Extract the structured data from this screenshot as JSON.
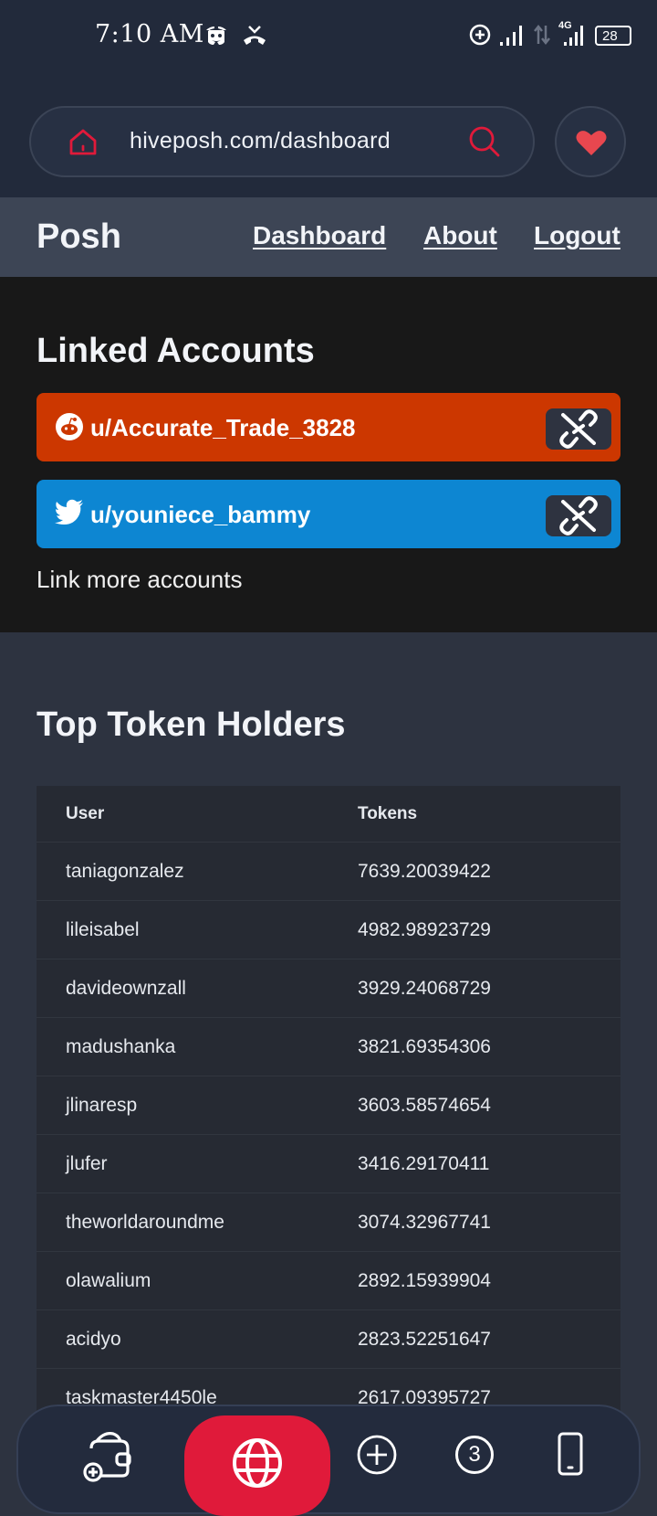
{
  "status": {
    "time": "7:10 AM",
    "network": "4G",
    "battery": "28"
  },
  "browser": {
    "url": "hiveposh.com/dashboard",
    "icons": [
      "home-icon",
      "search-icon",
      "heart-icon"
    ]
  },
  "nav": {
    "brand": "Posh",
    "links": [
      "Dashboard",
      "About",
      "Logout"
    ]
  },
  "linked": {
    "title": "Linked Accounts",
    "accounts": [
      {
        "platform": "reddit",
        "name": "u/Accurate_Trade_3828",
        "color": "#cc3700"
      },
      {
        "platform": "twitter",
        "name": "u/youniece_bammy",
        "color": "#0d86d2"
      }
    ],
    "link_more": "Link more accounts"
  },
  "holders": {
    "title": "Top Token Holders",
    "columns": [
      "User",
      "Tokens"
    ],
    "rows": [
      {
        "user": "taniagonzalez",
        "tokens": "7639.20039422"
      },
      {
        "user": "lileisabel",
        "tokens": "4982.98923729"
      },
      {
        "user": "davideownzall",
        "tokens": "3929.24068729"
      },
      {
        "user": "madushanka",
        "tokens": "3821.69354306"
      },
      {
        "user": "jlinaresp",
        "tokens": "3603.58574654"
      },
      {
        "user": "jlufer",
        "tokens": "3416.29170411"
      },
      {
        "user": "theworldaroundme",
        "tokens": "3074.32967741"
      },
      {
        "user": "olawalium",
        "tokens": "2892.15939904"
      },
      {
        "user": "acidyo",
        "tokens": "2823.52251647"
      },
      {
        "user": "taskmaster4450le",
        "tokens": "2617.09395727"
      }
    ]
  },
  "bottom_nav": {
    "tab_count": "3",
    "icons": [
      "wallet-icon",
      "globe-icon",
      "plus-circle-icon",
      "tabs-icon",
      "phone-icon"
    ]
  },
  "colors": {
    "accent": "#e01a3a",
    "reddit": "#cc3700",
    "twitter": "#0d86d2"
  }
}
